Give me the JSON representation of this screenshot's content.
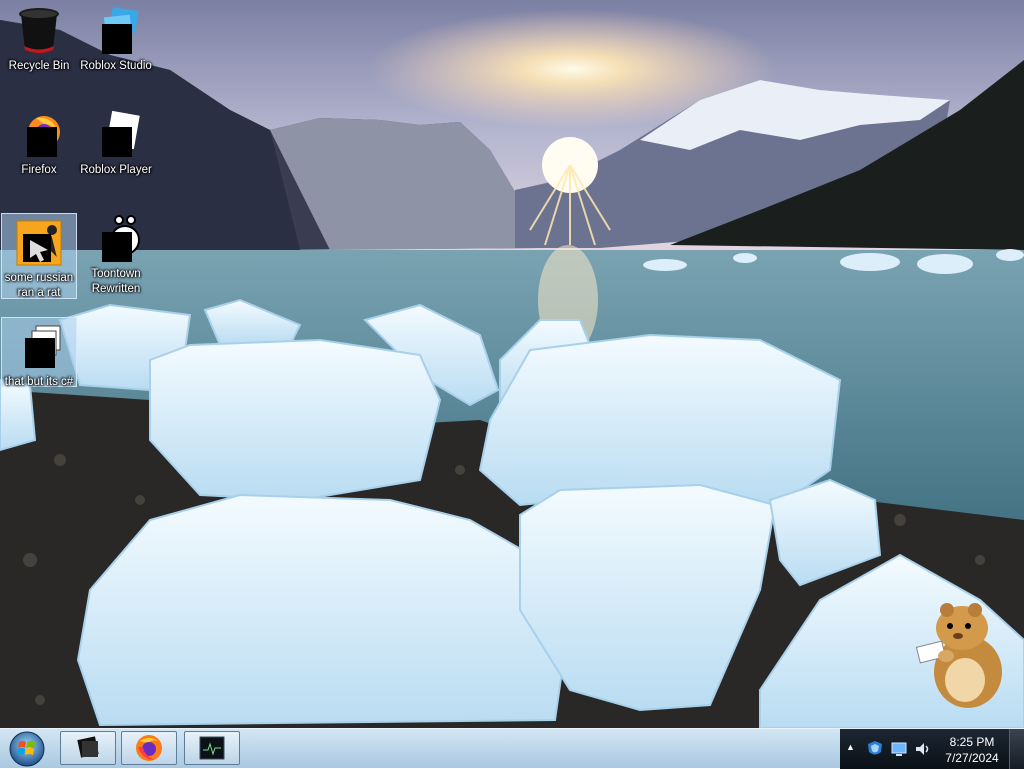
{
  "desktop": {
    "icons": [
      {
        "label": "Recycle Bin",
        "icon": "recycle-bin-icon"
      },
      {
        "label": "Roblox Studio",
        "icon": "roblox-studio-icon"
      },
      {
        "label": "Firefox",
        "icon": "firefox-icon"
      },
      {
        "label": "Roblox Player",
        "icon": "roblox-player-icon"
      },
      {
        "label": "some russian ran a rat",
        "icon": "cursor-app-icon"
      },
      {
        "label": "Toontown Rewritten",
        "icon": "toontown-icon"
      },
      {
        "label": "that but its c#",
        "icon": "application-icon"
      }
    ],
    "wallpaper": "glacier-lake-icebergs-sunset",
    "widget": "hamster-reading-icon"
  },
  "taskbar": {
    "start_icon": "windows-orb-icon",
    "buttons": [
      {
        "icon": "roblox-studio-icon"
      },
      {
        "icon": "firefox-icon"
      },
      {
        "icon": "monitor-icon"
      }
    ],
    "tray": {
      "icons": [
        "show-hidden-icons-arrow",
        "defender-icon",
        "network-icon",
        "volume-icon"
      ],
      "time": "8:25 PM",
      "date": "7/27/2024"
    }
  },
  "colors": {
    "taskbar": "#bcd6ea",
    "tray": "#0a1016",
    "selection": "#aacdeb"
  }
}
